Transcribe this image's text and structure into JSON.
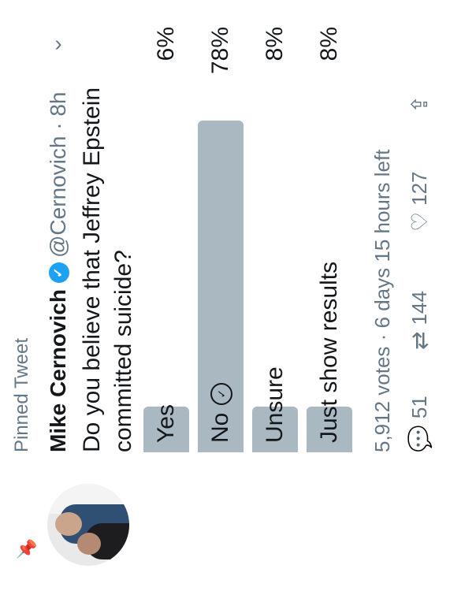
{
  "pinned_label": "Pinned Tweet",
  "author": {
    "name": "Mike Cernovich",
    "handle_time": "@Cernovich · 8h",
    "verified": true
  },
  "question_lines": [
    "Do you believe that Jeffrey Epstein",
    "committed suicide?"
  ],
  "poll": {
    "options": [
      {
        "label": "Yes",
        "percent": 6,
        "percent_text": "6%"
      },
      {
        "label": "No",
        "percent": 78,
        "percent_text": "78%",
        "selected": true
      },
      {
        "label": "Unsure",
        "percent": 8,
        "percent_text": "8%"
      },
      {
        "label": "Just show results",
        "percent": 8,
        "percent_text": "8%"
      }
    ],
    "votes_text": "5,912 votes · 6 days 15 hours left"
  },
  "actions": {
    "reply_count": "51",
    "retweet_count": "144",
    "like_count": "127"
  },
  "icons": {
    "pin": "pin-icon",
    "verified": "verified-badge-icon",
    "chevron": "chevron-down-icon",
    "check": "check-circle-icon",
    "reply": "reply-icon",
    "retweet": "retweet-icon",
    "like": "heart-icon",
    "share": "share-icon"
  },
  "colors": {
    "bar": "#aab8c2",
    "verified": "#1da1f2",
    "muted": "#657786",
    "text": "#14171a"
  }
}
